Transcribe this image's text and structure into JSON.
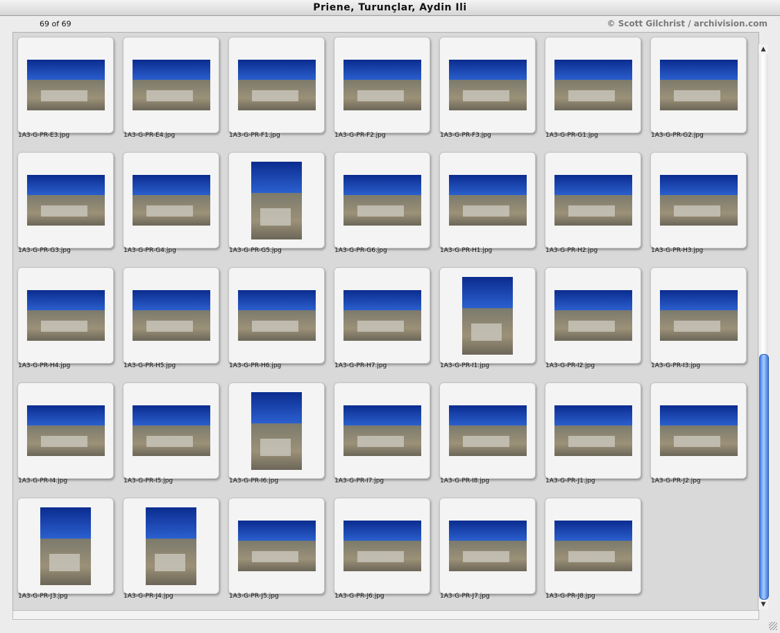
{
  "window": {
    "title": "Priene, Turunçlar, Aydin Ili",
    "count": "69 of 69",
    "credit": "© Scott Gilchrist / archivision.com"
  },
  "thumbnails": [
    {
      "name": "1A3-G-PR-E3.jpg",
      "orientation": "landscape"
    },
    {
      "name": "1A3-G-PR-E4.jpg",
      "orientation": "landscape"
    },
    {
      "name": "1A3-G-PR-F1.jpg",
      "orientation": "landscape"
    },
    {
      "name": "1A3-G-PR-F2.jpg",
      "orientation": "landscape"
    },
    {
      "name": "1A3-G-PR-F3.jpg",
      "orientation": "landscape"
    },
    {
      "name": "1A3-G-PR-G1.jpg",
      "orientation": "landscape"
    },
    {
      "name": "1A3-G-PR-G2.jpg",
      "orientation": "landscape"
    },
    {
      "name": "1A3-G-PR-G3.jpg",
      "orientation": "landscape"
    },
    {
      "name": "1A3-G-PR-G4.jpg",
      "orientation": "landscape"
    },
    {
      "name": "1A3-G-PR-G5.jpg",
      "orientation": "portrait"
    },
    {
      "name": "1A3-G-PR-G6.jpg",
      "orientation": "landscape"
    },
    {
      "name": "1A3-G-PR-H1.jpg",
      "orientation": "landscape"
    },
    {
      "name": "1A3-G-PR-H2.jpg",
      "orientation": "landscape"
    },
    {
      "name": "1A3-G-PR-H3.jpg",
      "orientation": "landscape"
    },
    {
      "name": "1A3-G-PR-H4.jpg",
      "orientation": "landscape"
    },
    {
      "name": "1A3-G-PR-H5.jpg",
      "orientation": "landscape"
    },
    {
      "name": "1A3-G-PR-H6.jpg",
      "orientation": "landscape"
    },
    {
      "name": "1A3-G-PR-H7.jpg",
      "orientation": "landscape"
    },
    {
      "name": "1A3-G-PR-I1.jpg",
      "orientation": "portrait"
    },
    {
      "name": "1A3-G-PR-I2.jpg",
      "orientation": "landscape"
    },
    {
      "name": "1A3-G-PR-I3.jpg",
      "orientation": "landscape"
    },
    {
      "name": "1A3-G-PR-I4.jpg",
      "orientation": "landscape"
    },
    {
      "name": "1A3-G-PR-I5.jpg",
      "orientation": "landscape"
    },
    {
      "name": "1A3-G-PR-I6.jpg",
      "orientation": "portrait"
    },
    {
      "name": "1A3-G-PR-I7.jpg",
      "orientation": "landscape"
    },
    {
      "name": "1A3-G-PR-I8.jpg",
      "orientation": "landscape"
    },
    {
      "name": "1A3-G-PR-J1.jpg",
      "orientation": "landscape"
    },
    {
      "name": "1A3-G-PR-J2.jpg",
      "orientation": "landscape"
    },
    {
      "name": "1A3-G-PR-J3.jpg",
      "orientation": "portrait"
    },
    {
      "name": "1A3-G-PR-J4.jpg",
      "orientation": "portrait"
    },
    {
      "name": "1A3-G-PR-J5.jpg",
      "orientation": "landscape"
    },
    {
      "name": "1A3-G-PR-J6.jpg",
      "orientation": "landscape"
    },
    {
      "name": "1A3-G-PR-J7.jpg",
      "orientation": "landscape"
    },
    {
      "name": "1A3-G-PR-J8.jpg",
      "orientation": "landscape"
    }
  ],
  "scrollbar": {
    "up_icon": "arrow-up-icon",
    "down_icon": "arrow-down-icon",
    "position": 0.55
  }
}
